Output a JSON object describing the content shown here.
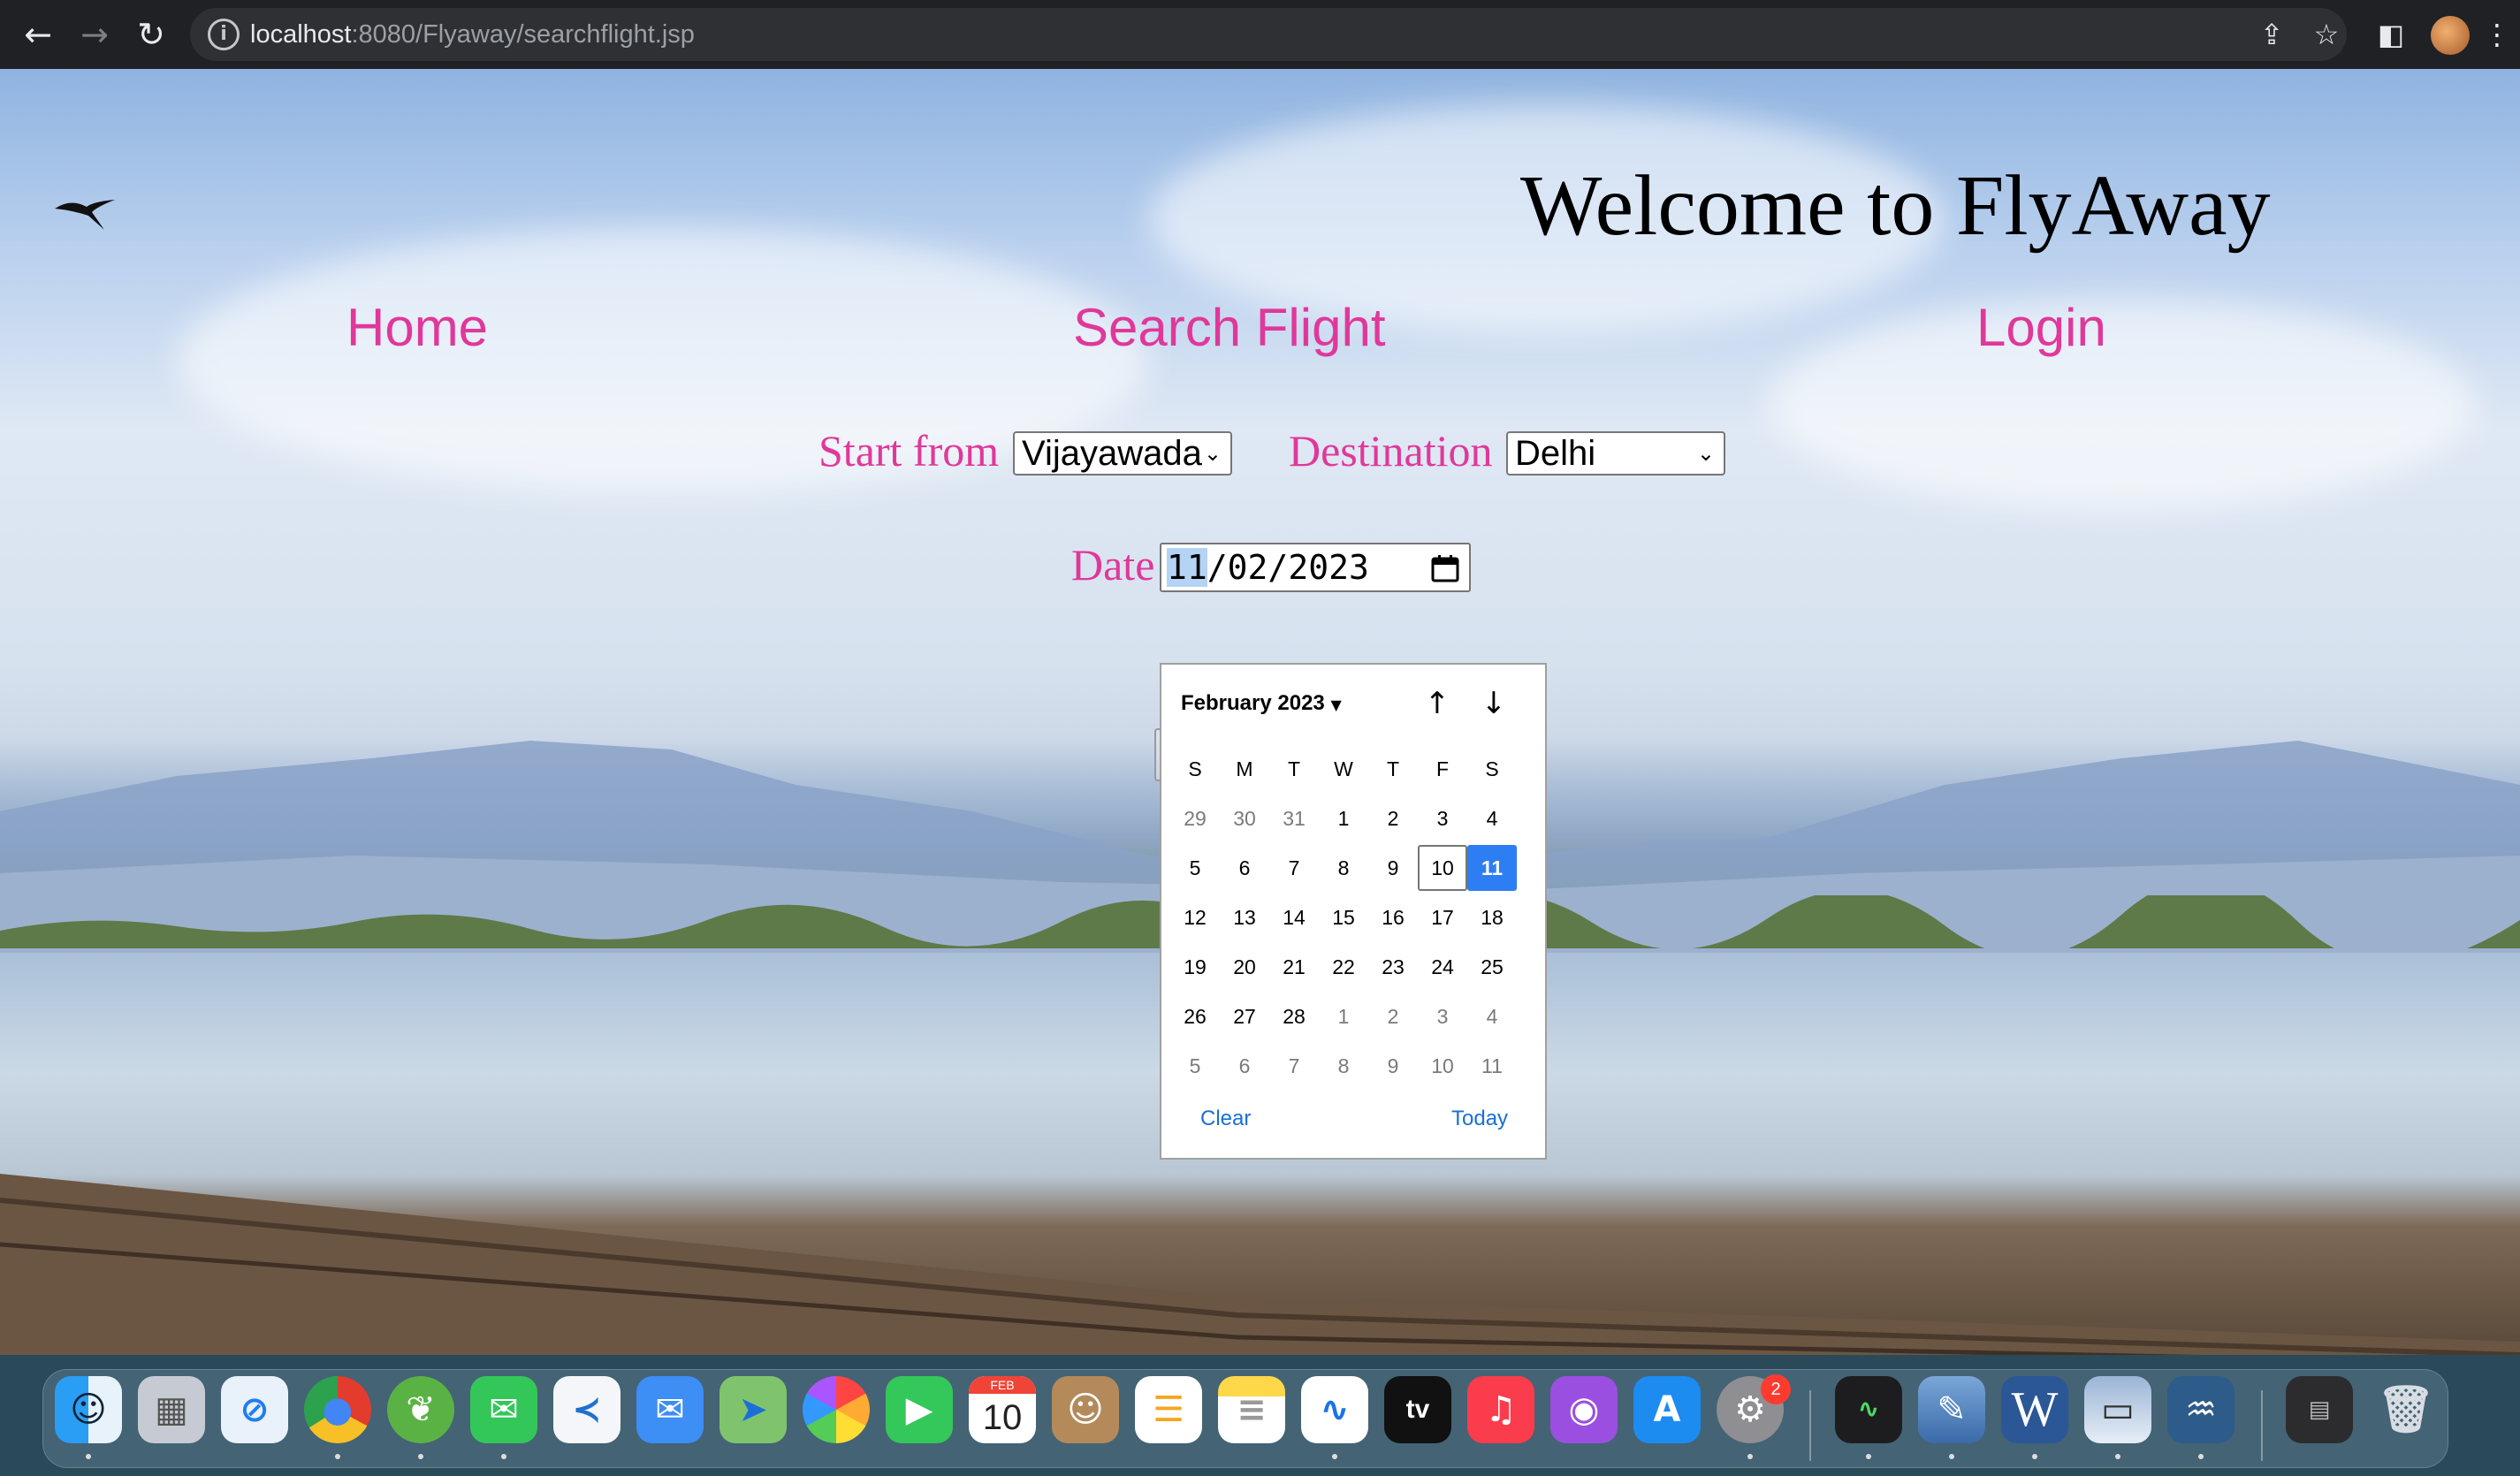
{
  "browser": {
    "url_host": "localhost",
    "url_rest": ":8080/Flyaway/searchflight.jsp"
  },
  "page": {
    "title": "Welcome to FlyAway",
    "nav": [
      {
        "label": "Home"
      },
      {
        "label": "Search Flight"
      },
      {
        "label": "Login"
      }
    ],
    "form": {
      "start_label": "Start from",
      "start_value": "Vijayawada",
      "destination_label": "Destination",
      "destination_value": "Delhi",
      "date_label": "Date",
      "date_month": "11",
      "date_day": "02",
      "date_year": "2023"
    }
  },
  "calendar": {
    "month_label": "February 2023",
    "weekdays": [
      "S",
      "M",
      "T",
      "W",
      "T",
      "F",
      "S"
    ],
    "weeks": [
      [
        "29",
        "30",
        "31",
        "1",
        "2",
        "3",
        "4"
      ],
      [
        "5",
        "6",
        "7",
        "8",
        "9",
        "10",
        "11"
      ],
      [
        "12",
        "13",
        "14",
        "15",
        "16",
        "17",
        "18"
      ],
      [
        "19",
        "20",
        "21",
        "22",
        "23",
        "24",
        "25"
      ],
      [
        "26",
        "27",
        "28",
        "1",
        "2",
        "3",
        "4"
      ],
      [
        "5",
        "6",
        "7",
        "8",
        "9",
        "10",
        "11"
      ]
    ],
    "today": "10",
    "selected": "11",
    "clear_label": "Clear",
    "today_label": "Today"
  },
  "dock": {
    "calendar_month": "FEB",
    "calendar_day": "10",
    "appletv_label": "tv",
    "word_label": "W",
    "settings_badge": "2"
  }
}
